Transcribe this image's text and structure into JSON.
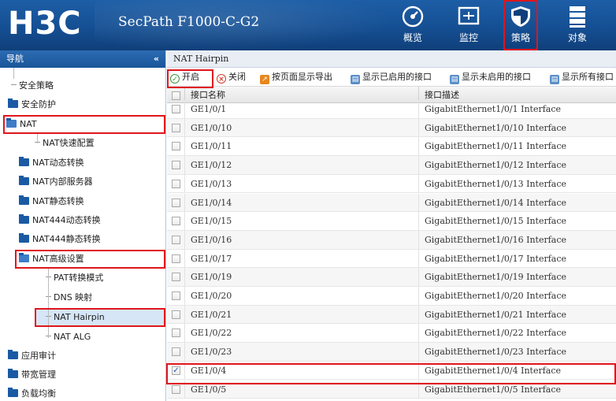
{
  "header": {
    "logo": "H3C",
    "product": "SecPath F1000-C-G2",
    "nav": [
      {
        "label": "概览",
        "icon": "overview-icon"
      },
      {
        "label": "监控",
        "icon": "monitor-icon"
      },
      {
        "label": "策略",
        "icon": "shield-icon"
      },
      {
        "label": "对象",
        "icon": "object-icon"
      }
    ]
  },
  "sidebar": {
    "title": "导航",
    "collapse_glyph": "«",
    "items": [
      {
        "label": "安全策略",
        "type": "leaf"
      },
      {
        "label": "安全防护",
        "type": "folder"
      },
      {
        "label": "NAT",
        "type": "folder-open"
      },
      {
        "label": "NAT快速配置",
        "type": "leaf"
      },
      {
        "label": "NAT动态转换",
        "type": "folder"
      },
      {
        "label": "NAT内部服务器",
        "type": "folder"
      },
      {
        "label": "NAT静态转换",
        "type": "folder"
      },
      {
        "label": "NAT444动态转换",
        "type": "folder"
      },
      {
        "label": "NAT444静态转换",
        "type": "folder"
      },
      {
        "label": "NAT高级设置",
        "type": "folder-open"
      },
      {
        "label": "PAT转换模式",
        "type": "leaf"
      },
      {
        "label": "DNS 映射",
        "type": "leaf"
      },
      {
        "label": "NAT Hairpin",
        "type": "leaf"
      },
      {
        "label": "NAT ALG",
        "type": "leaf"
      },
      {
        "label": "应用审计",
        "type": "folder"
      },
      {
        "label": "带宽管理",
        "type": "folder"
      },
      {
        "label": "负载均衡",
        "type": "folder"
      }
    ]
  },
  "main": {
    "title": "NAT Hairpin",
    "toolbar": [
      {
        "label": "开启",
        "icon": "check-circle-icon"
      },
      {
        "label": "关闭",
        "icon": "close-circle-icon"
      },
      {
        "label": "按页面显示导出",
        "icon": "export-icon"
      },
      {
        "label": "显示已启用的接口",
        "icon": "show-enabled-icon"
      },
      {
        "label": "显示未启用的接口",
        "icon": "show-disabled-icon"
      },
      {
        "label": "显示所有接口",
        "icon": "show-all-icon"
      }
    ],
    "columns": [
      "接口名称",
      "接口描述"
    ],
    "rows": [
      {
        "name": "GE1/0/1",
        "desc": "GigabitEthernet1/0/1 Interface",
        "checked": false
      },
      {
        "name": "GE1/0/10",
        "desc": "GigabitEthernet1/0/10 Interface",
        "checked": false
      },
      {
        "name": "GE1/0/11",
        "desc": "GigabitEthernet1/0/11 Interface",
        "checked": false
      },
      {
        "name": "GE1/0/12",
        "desc": "GigabitEthernet1/0/12 Interface",
        "checked": false
      },
      {
        "name": "GE1/0/13",
        "desc": "GigabitEthernet1/0/13 Interface",
        "checked": false
      },
      {
        "name": "GE1/0/14",
        "desc": "GigabitEthernet1/0/14 Interface",
        "checked": false
      },
      {
        "name": "GE1/0/15",
        "desc": "GigabitEthernet1/0/15 Interface",
        "checked": false
      },
      {
        "name": "GE1/0/16",
        "desc": "GigabitEthernet1/0/16 Interface",
        "checked": false
      },
      {
        "name": "GE1/0/17",
        "desc": "GigabitEthernet1/0/17 Interface",
        "checked": false
      },
      {
        "name": "GE1/0/19",
        "desc": "GigabitEthernet1/0/19 Interface",
        "checked": false
      },
      {
        "name": "GE1/0/20",
        "desc": "GigabitEthernet1/0/20 Interface",
        "checked": false
      },
      {
        "name": "GE1/0/21",
        "desc": "GigabitEthernet1/0/21 Interface",
        "checked": false
      },
      {
        "name": "GE1/0/22",
        "desc": "GigabitEthernet1/0/22 Interface",
        "checked": false
      },
      {
        "name": "GE1/0/23",
        "desc": "GigabitEthernet1/0/23 Interface",
        "checked": false
      },
      {
        "name": "GE1/0/4",
        "desc": "GigabitEthernet1/0/4 Interface",
        "checked": true
      },
      {
        "name": "GE1/0/5",
        "desc": "GigabitEthernet1/0/5 Interface",
        "checked": false
      }
    ],
    "check_glyph": "✓"
  },
  "colors": {
    "header": "#154f93",
    "highlight_frame": "#e0151c",
    "selected_row": "#d6e6f7"
  }
}
